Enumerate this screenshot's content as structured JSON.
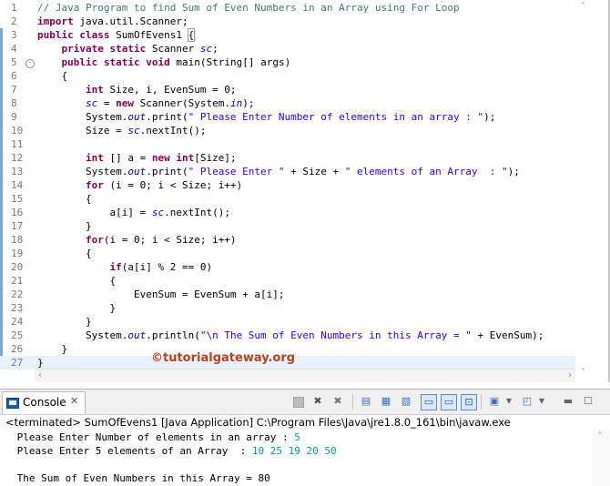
{
  "editor": {
    "file_class": "SumOfEvens1",
    "lines": [
      {
        "n": "1",
        "fold": "",
        "segs": [
          {
            "t": "// Java Program to find Sum of Even Numbers in an Array using For Loop",
            "c": "cm"
          }
        ]
      },
      {
        "n": "2",
        "fold": "",
        "segs": [
          {
            "t": "import",
            "c": "kw"
          },
          {
            "t": " java.util.Scanner;",
            "c": ""
          }
        ]
      },
      {
        "n": "3",
        "fold": "",
        "segs": [
          {
            "t": "public",
            "c": "kw"
          },
          {
            "t": " ",
            "c": ""
          },
          {
            "t": "class",
            "c": "kw"
          },
          {
            "t": " SumOfEvens1 ",
            "c": ""
          },
          {
            "t": "{",
            "c": "brk"
          }
        ]
      },
      {
        "n": "4",
        "fold": "",
        "segs": [
          {
            "t": "    ",
            "c": ""
          },
          {
            "t": "private",
            "c": "kw"
          },
          {
            "t": " ",
            "c": ""
          },
          {
            "t": "static",
            "c": "kw"
          },
          {
            "t": " Scanner ",
            "c": ""
          },
          {
            "t": "sc",
            "c": "fld"
          },
          {
            "t": ";",
            "c": ""
          }
        ]
      },
      {
        "n": "5",
        "fold": "-",
        "segs": [
          {
            "t": "    ",
            "c": ""
          },
          {
            "t": "public",
            "c": "kw"
          },
          {
            "t": " ",
            "c": ""
          },
          {
            "t": "static",
            "c": "kw"
          },
          {
            "t": " ",
            "c": ""
          },
          {
            "t": "void",
            "c": "kw"
          },
          {
            "t": " main(String[] args)",
            "c": ""
          }
        ]
      },
      {
        "n": "6",
        "fold": "",
        "segs": [
          {
            "t": "    {",
            "c": ""
          }
        ]
      },
      {
        "n": "7",
        "fold": "",
        "segs": [
          {
            "t": "        ",
            "c": ""
          },
          {
            "t": "int",
            "c": "kw"
          },
          {
            "t": " Size, i, EvenSum = 0;",
            "c": ""
          }
        ]
      },
      {
        "n": "8",
        "fold": "",
        "segs": [
          {
            "t": "        ",
            "c": ""
          },
          {
            "t": "sc",
            "c": "fld"
          },
          {
            "t": " = ",
            "c": ""
          },
          {
            "t": "new",
            "c": "kw"
          },
          {
            "t": " Scanner(System.",
            "c": ""
          },
          {
            "t": "in",
            "c": "fld"
          },
          {
            "t": ");",
            "c": ""
          }
        ]
      },
      {
        "n": "9",
        "fold": "",
        "segs": [
          {
            "t": "        System.",
            "c": ""
          },
          {
            "t": "out",
            "c": "fld"
          },
          {
            "t": ".print(",
            "c": ""
          },
          {
            "t": "\" Please Enter Number of elements in an array : \"",
            "c": "str"
          },
          {
            "t": ");",
            "c": ""
          }
        ]
      },
      {
        "n": "10",
        "fold": "",
        "segs": [
          {
            "t": "        Size = ",
            "c": ""
          },
          {
            "t": "sc",
            "c": "fld"
          },
          {
            "t": ".nextInt();",
            "c": ""
          }
        ]
      },
      {
        "n": "11",
        "fold": "",
        "segs": []
      },
      {
        "n": "12",
        "fold": "",
        "segs": [
          {
            "t": "        ",
            "c": ""
          },
          {
            "t": "int",
            "c": "kw"
          },
          {
            "t": " [] a = ",
            "c": ""
          },
          {
            "t": "new",
            "c": "kw"
          },
          {
            "t": " ",
            "c": ""
          },
          {
            "t": "int",
            "c": "kw"
          },
          {
            "t": "[Size];",
            "c": ""
          }
        ]
      },
      {
        "n": "13",
        "fold": "",
        "segs": [
          {
            "t": "        System.",
            "c": ""
          },
          {
            "t": "out",
            "c": "fld"
          },
          {
            "t": ".print(",
            "c": ""
          },
          {
            "t": "\" Please Enter \"",
            "c": "str"
          },
          {
            "t": " + Size + ",
            "c": ""
          },
          {
            "t": "\" elements of an Array  : \"",
            "c": "str"
          },
          {
            "t": ");",
            "c": ""
          }
        ]
      },
      {
        "n": "14",
        "fold": "",
        "segs": [
          {
            "t": "        ",
            "c": ""
          },
          {
            "t": "for",
            "c": "kw"
          },
          {
            "t": " (i = 0; i < Size; i++)",
            "c": ""
          }
        ]
      },
      {
        "n": "15",
        "fold": "",
        "segs": [
          {
            "t": "        {",
            "c": ""
          }
        ]
      },
      {
        "n": "16",
        "fold": "",
        "segs": [
          {
            "t": "            a[i] = ",
            "c": ""
          },
          {
            "t": "sc",
            "c": "fld"
          },
          {
            "t": ".nextInt();",
            "c": ""
          }
        ]
      },
      {
        "n": "17",
        "fold": "",
        "segs": [
          {
            "t": "        }",
            "c": ""
          }
        ]
      },
      {
        "n": "18",
        "fold": "",
        "segs": [
          {
            "t": "        ",
            "c": ""
          },
          {
            "t": "for",
            "c": "kw"
          },
          {
            "t": "(i = 0; i < Size; i++)",
            "c": ""
          }
        ]
      },
      {
        "n": "19",
        "fold": "",
        "segs": [
          {
            "t": "        {",
            "c": ""
          }
        ]
      },
      {
        "n": "20",
        "fold": "",
        "segs": [
          {
            "t": "            ",
            "c": ""
          },
          {
            "t": "if",
            "c": "kw"
          },
          {
            "t": "(a[i] % 2 == 0)",
            "c": ""
          }
        ]
      },
      {
        "n": "21",
        "fold": "",
        "segs": [
          {
            "t": "            {",
            "c": ""
          }
        ]
      },
      {
        "n": "22",
        "fold": "",
        "segs": [
          {
            "t": "                EvenSum = EvenSum + a[i];",
            "c": ""
          }
        ]
      },
      {
        "n": "23",
        "fold": "",
        "segs": [
          {
            "t": "            }",
            "c": ""
          }
        ]
      },
      {
        "n": "24",
        "fold": "",
        "segs": [
          {
            "t": "        }",
            "c": ""
          }
        ]
      },
      {
        "n": "25",
        "fold": "",
        "segs": [
          {
            "t": "        System.",
            "c": ""
          },
          {
            "t": "out",
            "c": "fld"
          },
          {
            "t": ".println(",
            "c": ""
          },
          {
            "t": "\"\\n The Sum of Even Numbers in this Array = \"",
            "c": "str"
          },
          {
            "t": " + EvenSum);",
            "c": ""
          }
        ]
      },
      {
        "n": "26",
        "fold": "",
        "segs": [
          {
            "t": "    }",
            "c": ""
          }
        ]
      },
      {
        "n": "27",
        "fold": "",
        "segs": [
          {
            "t": "}",
            "c": ""
          }
        ]
      }
    ],
    "watermark": "©tutorialgateway.org"
  },
  "console": {
    "tab_label": "Console",
    "tab_close": "✕",
    "terminated": "<terminated> SumOfEvens1 [Java Application] C:\\Program Files\\Java\\jre1.8.0_161\\bin\\javaw.exe",
    "output": [
      {
        "prompt": " Please Enter Number of elements in an array : ",
        "input": "5"
      },
      {
        "prompt": " Please Enter 5 elements of an Array  : ",
        "input": "10 25 19 20 50"
      },
      {
        "prompt": "",
        "input": ""
      },
      {
        "prompt": " The Sum of Even Numbers in this Array = 80",
        "input": ""
      }
    ]
  },
  "icons": [
    "terminate-icon",
    "remove-launch-icon",
    "remove-all-icon",
    "clear-console-icon",
    "scroll-lock-icon",
    "word-wrap-icon",
    "show-on-output-icon",
    "show-on-error-icon",
    "pin-console-icon",
    "display-console-icon",
    "new-console-icon",
    "minimize-icon",
    "maximize-icon"
  ]
}
